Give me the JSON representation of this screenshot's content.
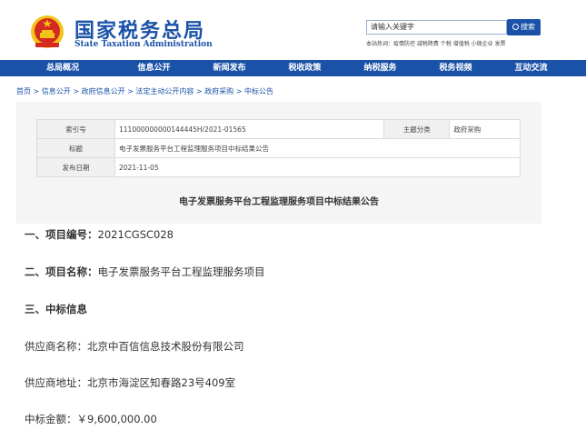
{
  "header": {
    "logo_cn": "国家税务总局",
    "logo_en": "State Taxation Administration",
    "search_placeholder": "请输入关键字",
    "search_button": "搜索",
    "hot_words": "本站热词：疫情防控 减税降费 个税 增值税 小微企业 发票"
  },
  "nav": {
    "items": [
      "总局概况",
      "信息公开",
      "新闻发布",
      "税收政策",
      "纳税服务",
      "税务视频",
      "互动交流"
    ]
  },
  "breadcrumb": "首页 > 信息公开 > 政府信息公开 > 法定主动公开内容 > 政府采购 > 中标公告",
  "meta": {
    "index_label": "索引号",
    "index_value": "111000000000144445H/2021-01565",
    "category_label": "主题分类",
    "category_value": "政府采购",
    "title_label": "标题",
    "title_value": "电子发票服务平台工程监理服务项目中标结果公告",
    "date_label": "发布日期",
    "date_value": "2021-11-05"
  },
  "doc_title": "电子发票服务平台工程监理服务项目中标结果公告",
  "content": {
    "s1_label": "一、项目编号：",
    "s1_value": "2021CGSC028",
    "s2_label": "二、项目名称：",
    "s2_value": "电子发票服务平台工程监理服务项目",
    "s3_label": "三、中标信息",
    "supplier_name": "供应商名称：北京中百信信息技术股份有限公司",
    "supplier_address": "供应商地址：北京市海淀区知春路23号409室",
    "amount": "中标金额：￥9,600,000.00"
  },
  "colors": {
    "brand": "#1a52a8",
    "emblem_red": "#d42a20",
    "emblem_gold": "#f2c318"
  }
}
